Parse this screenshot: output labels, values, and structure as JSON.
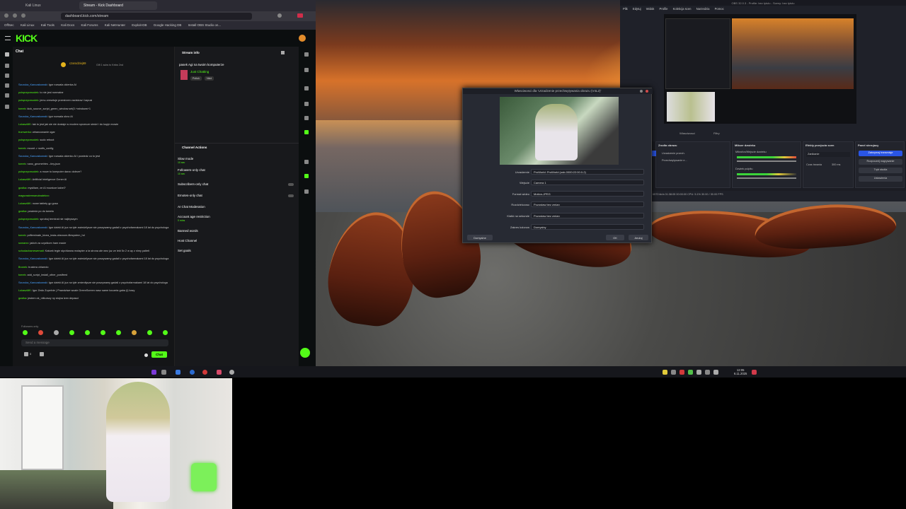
{
  "browser": {
    "tabs": [
      "Kali Linux",
      "Stream - Kick Dashboard"
    ],
    "url": "dashboard.kick.com/stream",
    "bookmarks": [
      "OffSec",
      "Kali Linux",
      "Kali Tools",
      "Kali Docs",
      "Kali Forums",
      "Kali NetHunter",
      "Exploit-DB",
      "Google Hacking DB",
      "Install OBS Studio on..."
    ]
  },
  "kick": {
    "logo": "KICK",
    "chat": {
      "title": "Chat",
      "pinned_user": "czarodziej69",
      "pinned_note": "Gift 1 subs to Kekw 2nd",
      "messages": [
        {
          "user": "Szczuka_Kanczakowski",
          "text": "Igor rozwala okienka AI"
        },
        {
          "user": "polsprzyrzwodek",
          "text": "to nie jest normalne"
        },
        {
          "user": "polsprzyrzwodek",
          "text": "jemu zresetuje przestrzen zaciskow i kapusi"
        },
        {
          "user": "tomek",
          "text": "kick_source_script_green_window:set(0.+windows+1"
        },
        {
          "user": "Szczuka_Kanczakowski",
          "text": "igor rozwala okno AI"
        },
        {
          "user": "LukaszMK",
          "text": "tak to jest jak sie nie dostaje w modem sprzecze siedzi i do kopje mowie"
        },
        {
          "user": "trumwerka",
          "text": "wtrancowanie ogar"
        },
        {
          "user": "polsprzyrzwodek",
          "text": "sudo reboot"
        },
        {
          "user": "tomek",
          "text": "mount -r rootfs_config"
        },
        {
          "user": "Szczuka_Kanczakowski",
          "text": "Igor rozwala okienko AI i powiedz co to jest"
        },
        {
          "user": "tomek",
          "text": "nano_geometries --tiny.json"
        },
        {
          "user": "polsprzyrzwodek",
          "text": "a moze to komputer darzo dobrze?"
        },
        {
          "user": "LukaszMK",
          "text": "Artificial Inteligence Gener Al"
        },
        {
          "user": "gostka",
          "text": "myslilam, ze AI mowicze kabel?"
        },
        {
          "user": "magvrastermanutradekxx",
          "text": ""
        },
        {
          "user": "LukaszMK",
          "text": "nowe tablety gp gosa"
        },
        {
          "user": "gostka",
          "text": "powiedz po do tweeto"
        },
        {
          "user": "polsprzyrzwodek",
          "text": "sprobuj terminal nie najlepszym"
        },
        {
          "user": "Szczuka_Kanczakowski",
          "text": "Igor dzieki AI juz na tyle zwiedzilysze sie poszywamy gadali z psychofarmakami 18 lat do psychologa"
        },
        {
          "user": "tomek",
          "text": "pdfieminate_kicea_insta-obsroom-filesystem_hd"
        },
        {
          "user": "ssmarxx",
          "text": "jakich za czyzikom ham macie"
        },
        {
          "user": "schodachamewemati",
          "text": "Katuek tegie stychlarwa motapter a ta strona ale wez juz ze lekt 5x 2 w ay z nimy palteti"
        },
        {
          "user": "Szczuka_Kanczakowski",
          "text": "Igor dzieki AI juz na tyle zwiedzilysze sie poszywamy gadali z psychofarmakami 18 lat do psychologa"
        },
        {
          "user": "Brunek",
          "text": "trustera chlamdo"
        },
        {
          "user": "tomek",
          "text": "add_script_install_other_postfeed"
        },
        {
          "user": "Szczuka_Kanczakowski",
          "text": "Igor dzieki AI juz na tyle zmienilysze sie poszywamy gadali z psychofarmakami 18 lat do psychologa"
        },
        {
          "user": "LukaszMK",
          "text": "Igor Zedo Zupelnie ( Prawdziwe wcale GreenScreen nasz same kouzeia gaba (i) bazy"
        },
        {
          "user": "gostka",
          "text": "jestem ok_nitkurszy ny stojna lzen depasci"
        }
      ],
      "followers_only": "Followers only",
      "input_placeholder": "Send a message",
      "send_label": "Chat",
      "points": "0"
    },
    "stream_info": {
      "title": "Stream info",
      "stream_title": "pasek Agi na twoim komputerze",
      "category": "Just Chatting",
      "tags": [
        "Polish",
        "Nkid"
      ]
    },
    "channel_actions": {
      "title": "Channel Actions",
      "items": [
        "Slow mode",
        "Followers-only chat",
        "Subscribers-only chat",
        "Emotes-only chat",
        "AI Chat Moderation",
        "Account age restriction",
        "Banned words",
        "Host Channel",
        "Set goals"
      ],
      "slow_mode_value": "10 sec",
      "followers_value": "10 sec",
      "account_value": "0 mins"
    }
  },
  "obs_dialog": {
    "title": "Wlasciwosci dla 'Urzadzenie przechwytywania obrazu (V4L2)'",
    "fields": [
      {
        "label": "Urzadzenie",
        "value": "ProWorld: ProWorld (usb-0000:22:00.0-2)"
      },
      {
        "label": "Wejscie",
        "value": "Camera 1"
      },
      {
        "label": "Format wideo",
        "value": "Motion-JPEG"
      },
      {
        "label": "Rozdzielczosc",
        "value": "Pozostaw bez zmian"
      },
      {
        "label": "Klatki na sekunde",
        "value": "Pozostaw bez zmian"
      },
      {
        "label": "Zakres kolorow",
        "value": "Domyslny"
      }
    ],
    "defaults_label": "Domyslne",
    "ok_label": "OK",
    "cancel_label": "Anuluj"
  },
  "obs": {
    "title": "OBS 32.0.3 - Profile: bez tytulu - Sceny: bez tytulu",
    "menu": [
      "Plik",
      "Edytuj",
      "Widok",
      "Profile",
      "Kolekcja scen",
      "Narzedzia",
      "Pomoc"
    ],
    "docks": {
      "sources_title": "Zrodla obrazu",
      "sources": [
        "Urzadzenie przech.",
        "Przechwytywanie e..."
      ],
      "mixer_title": "Mikser dzwieku",
      "mixer_items": [
        "Mikrofon/Wejscie dzwieku",
        "Dzwiek pulpitu"
      ],
      "transitions_title": "Efekty przejscia scen",
      "transition_value": "Zanikanie",
      "duration_label": "Czas trwania",
      "duration_value": "300 ms",
      "controls_title": "Panel sterujacy",
      "controls": [
        "Zatrzymaj transmisje",
        "Rozpocznij nagrywanie",
        "Tryb studia",
        "Ustawienia"
      ],
      "scenes_tab": "Wlasciwosci",
      "filters_tab": "Filtry"
    },
    "status": "Zgubione klatki 0 (0.0%)   6570 kb/s   01:38:05   00:00:00   CPU: 5.1%   30.00 / 30.00 FPS"
  },
  "taskbar": {
    "time": "12:05",
    "date": "6.11.2025"
  },
  "colors": {
    "kick_green": "#53fc18",
    "obs_accent": "#2a55e5",
    "webcam_green": "#7cf05a"
  }
}
